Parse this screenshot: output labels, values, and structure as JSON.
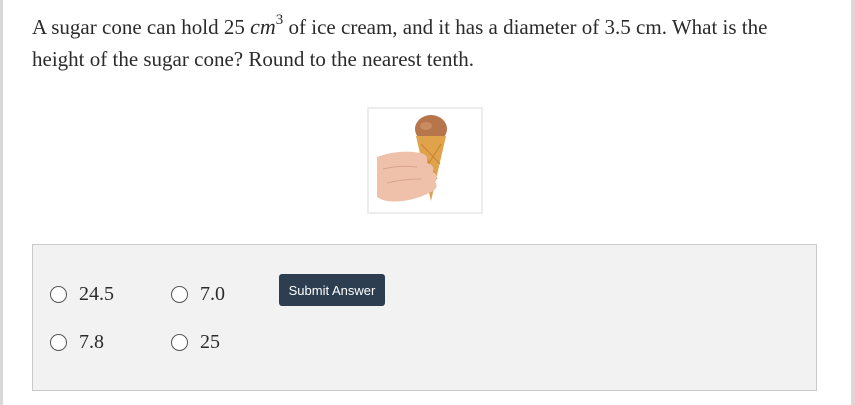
{
  "question": {
    "text_before": "A sugar cone can hold 25 ",
    "math_unit": "cm",
    "math_exponent": "3",
    "text_after": " of ice cream, and it has a diameter of 3.5 cm. What is the height of the sugar cone? Round to the nearest tenth."
  },
  "choices": [
    {
      "label": "24.5"
    },
    {
      "label": "7.0"
    },
    {
      "label": "7.8"
    },
    {
      "label": "25"
    }
  ],
  "submit": {
    "label": "Submit Answer"
  },
  "colors": {
    "submit_bg": "#2c3e50",
    "panel_bg": "#f2f2f2",
    "cone": "#e0a24a",
    "ice_cream": "#b7754c",
    "hand": "#efc1aa"
  }
}
